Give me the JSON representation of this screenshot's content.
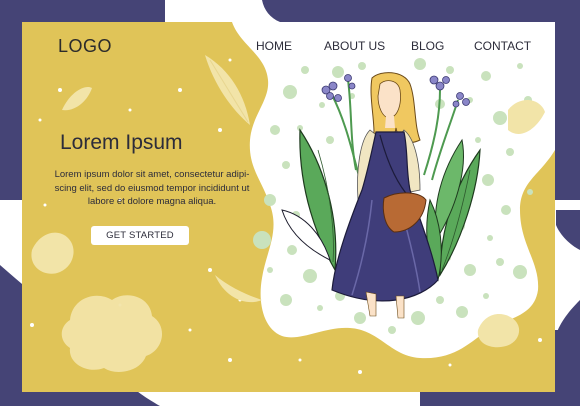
{
  "brand": {
    "logo_text": "LOGO"
  },
  "nav": {
    "items": [
      "HOME",
      "ABOUT US",
      "BLOG",
      "CONTACT"
    ]
  },
  "hero": {
    "title": "Lorem Ipsum",
    "body": "Lorem ipsum dolor sit amet, consectetur adipi-scing elit, sed do eiusmod tempor incididunt ut labore et dolore magna aliqua.",
    "cta_label": "GET STARTED"
  },
  "colors": {
    "mustard": "#e0c458",
    "navy": "#454476",
    "dress": "#3f3d7a",
    "leaf_green": "#5aa95a",
    "dot_green": "#c9e2bd",
    "hair": "#f0c860",
    "bag": "#b86a34",
    "leaf_pale": "#f2e4a8"
  },
  "illustration": {
    "icon": "woman-with-plants-illustration"
  }
}
